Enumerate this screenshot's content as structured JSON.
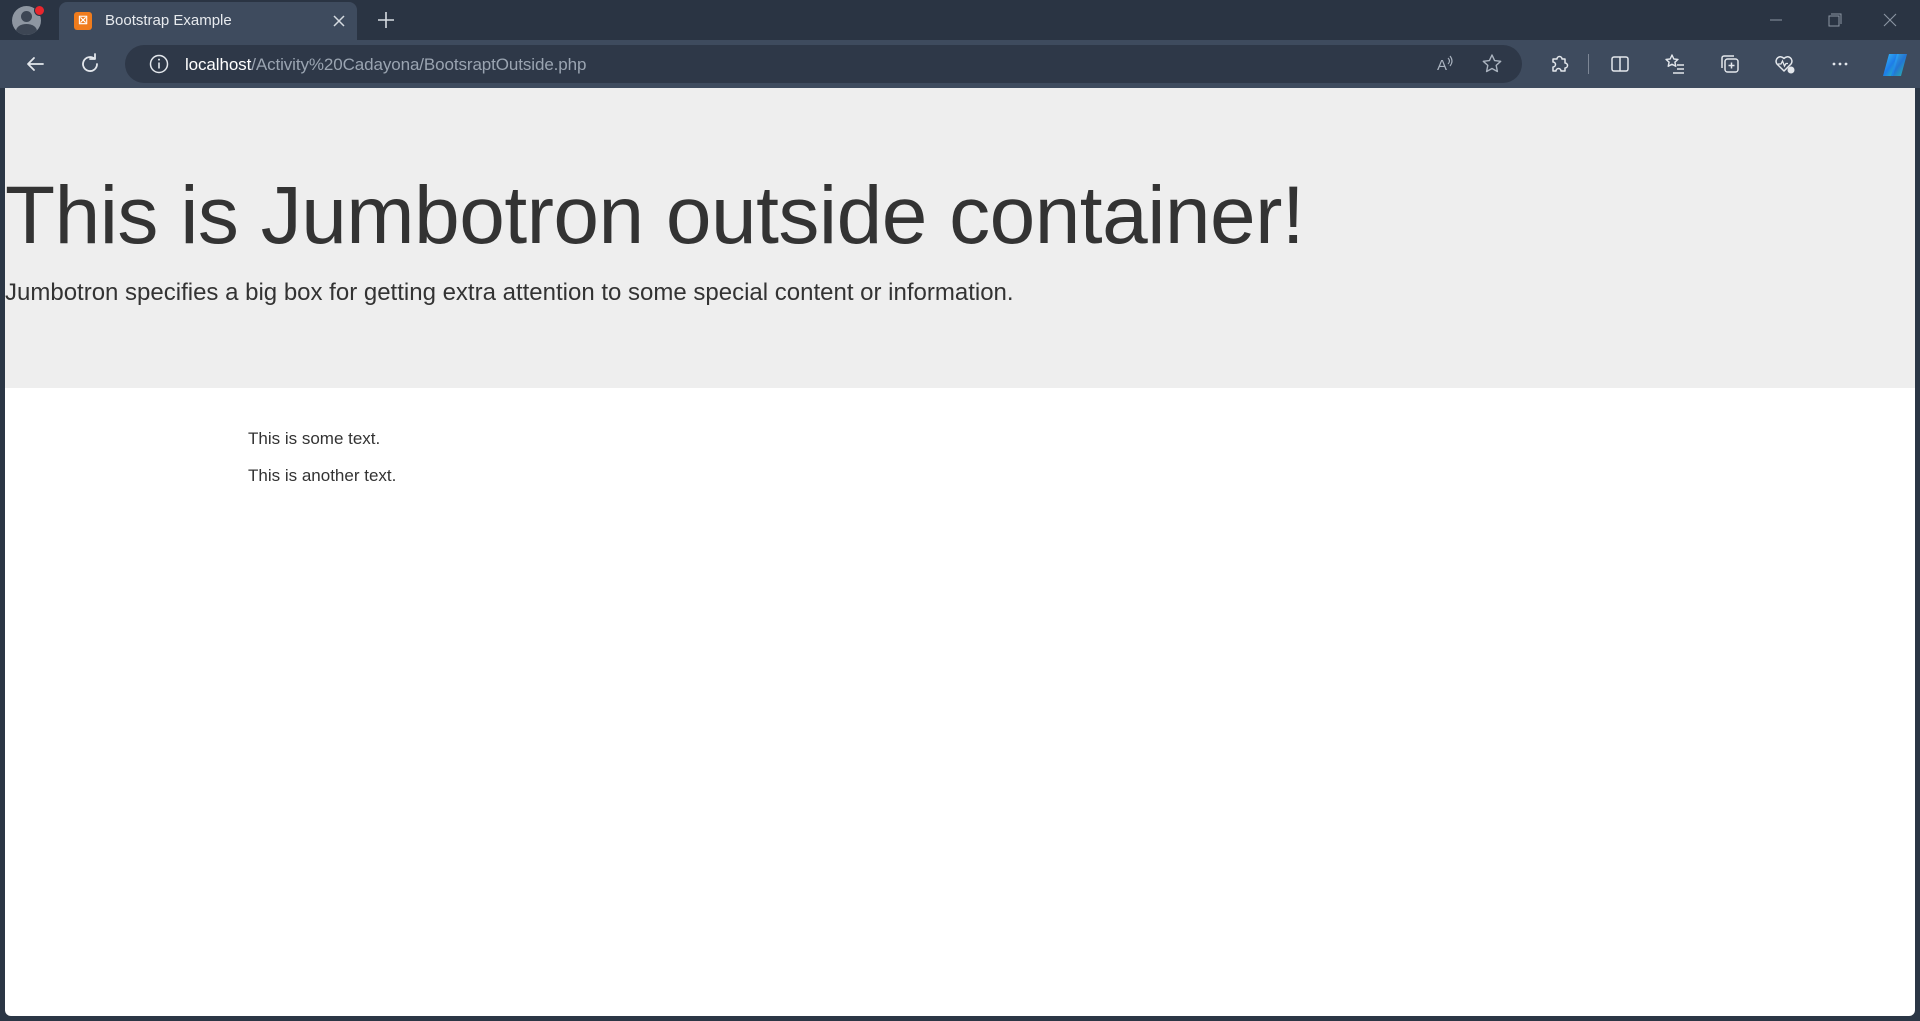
{
  "window": {
    "profile_icon": "profile-avatar-icon",
    "tab": {
      "title": "Bootstrap Example",
      "favicon_icon": "xampp-favicon-icon"
    },
    "new_tab_icon": "plus-icon",
    "controls": [
      "minimize-icon",
      "restore-icon",
      "close-icon"
    ]
  },
  "toolbar": {
    "back_icon": "back-arrow-icon",
    "refresh_icon": "refresh-icon",
    "site_info_icon": "info-icon",
    "url_host": "localhost",
    "url_path": "/Activity%20Cadayona/BootsraptOutside.php",
    "read_aloud_icon": "read-aloud-icon",
    "favorite_icon": "star-icon",
    "extensions_icon": "puzzle-icon",
    "split_screen_icon": "split-screen-icon",
    "favorites_icon": "favorites-list-icon",
    "collections_icon": "collections-icon",
    "browser_essentials_icon": "heart-pulse-icon",
    "more_icon": "more-icon",
    "copilot_icon": "copilot-icon"
  },
  "page": {
    "jumbotron": {
      "heading": "This is Jumbotron outside container!",
      "lead": "Jumbotron specifies a big box for getting extra attention to some special content or information."
    },
    "paragraphs": [
      "This is some text.",
      "This is another text."
    ]
  },
  "colors": {
    "jumbotron_bg": "#eeeeee",
    "page_text": "#333333",
    "tab_favicon": "#f07c1d",
    "profile_badge": "#e8262d"
  }
}
